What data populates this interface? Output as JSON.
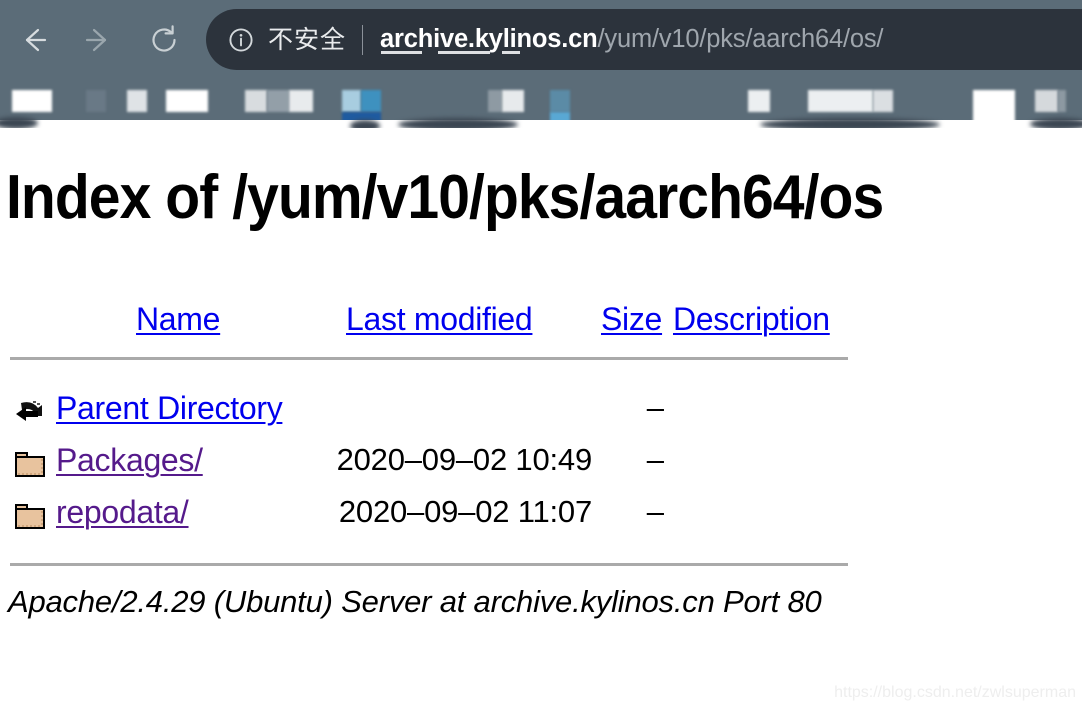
{
  "browser": {
    "nav": {
      "back_label": "Back",
      "back_icon": "arrow-left-icon",
      "forward_label": "Forward",
      "forward_icon": "arrow-right-icon",
      "reload_label": "Reload",
      "reload_icon": "reload-icon"
    },
    "omnibox": {
      "info_icon": "info-circle-icon",
      "security_label": "不安全",
      "url_host": "archive.kylinos.cn",
      "url_path": "/yum/v10/pks/aarch64/os/",
      "full_url": "archive.kylinos.cn/yum/v10/pks/aarch64/os/"
    },
    "bookmarks_bar": {
      "truncated_label": "]罹",
      "note": "blurred"
    },
    "colors": {
      "toolbar_bg": "#5b6c78",
      "omnibox_bg": "#2c333c",
      "url_host_color": "#ffffff",
      "url_path_color": "#9fa6ad"
    }
  },
  "page": {
    "title": "Index of /yum/v10/pks/aarch64/os",
    "columns": [
      {
        "label": "Name",
        "name": "column-header-name"
      },
      {
        "label": "Last modified",
        "name": "column-header-last-modified"
      },
      {
        "label": "Size",
        "name": "column-header-size"
      },
      {
        "label": "Description",
        "name": "column-header-description"
      }
    ],
    "rows": [
      {
        "icon": "back-arrow-icon",
        "name": "Parent Directory",
        "modified": "",
        "size": "–",
        "description": "",
        "visited": false
      },
      {
        "icon": "folder-icon",
        "name": "Packages/",
        "modified": "2020–09–02 10:49",
        "size": "–",
        "description": "",
        "visited": true
      },
      {
        "icon": "folder-icon",
        "name": "repodata/",
        "modified": "2020–09–02 11:07",
        "size": "–",
        "description": "",
        "visited": true
      }
    ],
    "footer": "Apache/2.4.29 (Ubuntu) Server at archive.kylinos.cn Port 80",
    "colors": {
      "link": "#0000ee",
      "link_visited": "#551a8b",
      "rule": "#aaaaaa"
    }
  },
  "watermark": "https://blog.csdn.net/zwlsuperman"
}
